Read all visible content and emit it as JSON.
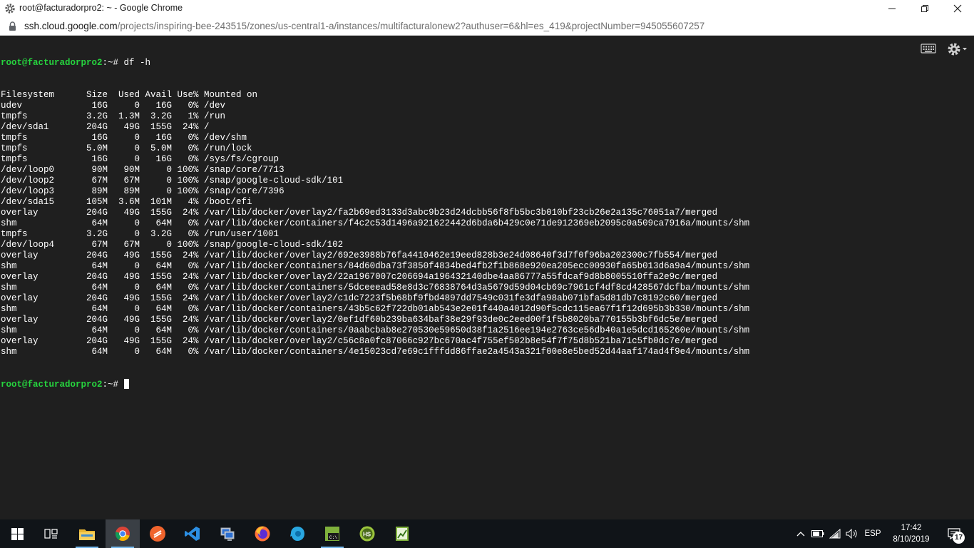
{
  "window": {
    "title": "root@facturadorpro2: ~ - Google Chrome",
    "url_host": "ssh.cloud.google.com",
    "url_path": "/projects/inspiring-bee-243515/zones/us-central1-a/instances/multifacturalonew2?authuser=6&hl=es_419&projectNumber=945055607257"
  },
  "terminal": {
    "prompt_user": "root@facturadorpro2",
    "prompt_path": ":~# ",
    "command": "df -h",
    "output": [
      "Filesystem      Size  Used Avail Use% Mounted on",
      "udev             16G     0   16G   0% /dev",
      "tmpfs           3.2G  1.3M  3.2G   1% /run",
      "/dev/sda1       204G   49G  155G  24% /",
      "tmpfs            16G     0   16G   0% /dev/shm",
      "tmpfs           5.0M     0  5.0M   0% /run/lock",
      "tmpfs            16G     0   16G   0% /sys/fs/cgroup",
      "/dev/loop0       90M   90M     0 100% /snap/core/7713",
      "/dev/loop2       67M   67M     0 100% /snap/google-cloud-sdk/101",
      "/dev/loop3       89M   89M     0 100% /snap/core/7396",
      "/dev/sda15      105M  3.6M  101M   4% /boot/efi",
      "overlay         204G   49G  155G  24% /var/lib/docker/overlay2/fa2b69ed3133d3abc9b23d24dcbb56f8fb5bc3b010bf23cb26e2a135c76051a7/merged",
      "shm              64M     0   64M   0% /var/lib/docker/containers/f4c2c53d1496a921622442d6bda6b429c0e71de912369eb2095c0a509ca7916a/mounts/shm",
      "tmpfs           3.2G     0  3.2G   0% /run/user/1001",
      "/dev/loop4       67M   67M     0 100% /snap/google-cloud-sdk/102",
      "overlay         204G   49G  155G  24% /var/lib/docker/overlay2/692e3988b76fa4410462e19eed828b3e24d08640f3d7f0f96ba202300c7fb554/merged",
      "shm              64M     0   64M   0% /var/lib/docker/containers/84d60dba73f3850f4834bed4fb2f1b868e920ea205ecc00930fa65b013d6a9a4/mounts/shm",
      "overlay         204G   49G  155G  24% /var/lib/docker/overlay2/22a1967007c206694a196432140dbe4aa86777a55fdcaf9d8b8005510ffa2e9c/merged",
      "shm              64M     0   64M   0% /var/lib/docker/containers/5dceeead58e8d3c76838764d3a5679d59d04cb69c7961cf4df8cd428567dcfba/mounts/shm",
      "overlay         204G   49G  155G  24% /var/lib/docker/overlay2/c1dc7223f5b68bf9fbd4897dd7549c031fe3dfa98ab071bfa5d81db7c8192c60/merged",
      "shm              64M     0   64M   0% /var/lib/docker/containers/43b5c62f722db01ab543e2e01f440a4012d90f5cdc115ea67f1f12d695b3b330/mounts/shm",
      "overlay         204G   49G  155G  24% /var/lib/docker/overlay2/0ef1df60b239ba634baf38e29f93de0c2eed00f1f5b8020ba770155b3bf6dc5e/merged",
      "shm              64M     0   64M   0% /var/lib/docker/containers/0aabcbab8e270530e59650d38f1a2516ee194e2763ce56db40a1e5dcd165260e/mounts/shm",
      "overlay         204G   49G  155G  24% /var/lib/docker/overlay2/c56c8a0fc87066c927bc670ac4f755ef502b8e54f7f75d8b521ba71c5fb0dc7e/merged",
      "shm              64M     0   64M   0% /var/lib/docker/containers/4e15023cd7e69c1fffdd86ffae2a4543a321f00e8e5bed52d44aaf174ad4f9e4/mounts/shm"
    ]
  },
  "taskbar": {
    "language": "ESP",
    "time": "17:42",
    "date": "8/10/2019",
    "notification_count": "17",
    "apps": [
      "start-icon",
      "task-view-icon",
      "file-explorer-icon",
      "chrome-icon",
      "sublime-text-icon",
      "vscode-icon",
      "remote-desktop-icon",
      "firefox-icon",
      "app-blue-icon",
      "terminal-icon",
      "heidisql-icon",
      "chart-app-icon"
    ]
  },
  "colors": {
    "terminal_bg": "#1f1f1f",
    "prompt": "#26d43e",
    "taskbar_bg": "#101418"
  }
}
